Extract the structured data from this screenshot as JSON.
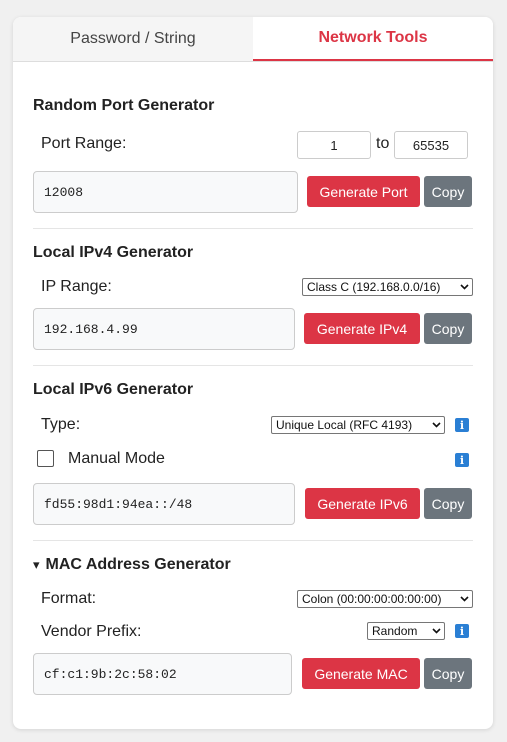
{
  "tabs": [
    {
      "label": "Password / String",
      "active": false
    },
    {
      "label": "Network Tools",
      "active": true
    }
  ],
  "port": {
    "title": "Random Port Generator",
    "range_label": "Port Range:",
    "min": "1",
    "to_label": "to",
    "max": "65535",
    "output": "12008",
    "generate_label": "Generate Port",
    "copy_label": "Copy"
  },
  "ipv4": {
    "title": "Local IPv4 Generator",
    "range_label": "IP Range:",
    "range_selected": "Class C (192.168.0.0/16)",
    "output": "192.168.4.99",
    "generate_label": "Generate IPv4",
    "copy_label": "Copy"
  },
  "ipv6": {
    "title": "Local IPv6 Generator",
    "type_label": "Type:",
    "type_selected": "Unique Local (RFC 4193)",
    "manual_label": "Manual Mode",
    "manual_checked": false,
    "output": "fd55:98d1:94ea::/48",
    "generate_label": "Generate IPv6",
    "copy_label": "Copy"
  },
  "mac": {
    "title": "MAC Address Generator",
    "collapse_glyph": "▾",
    "format_label": "Format:",
    "format_selected": "Colon (00:00:00:00:00:00)",
    "vendor_label": "Vendor Prefix:",
    "vendor_selected": "Random",
    "output": "cf:c1:9b:2c:58:02",
    "generate_label": "Generate MAC",
    "copy_label": "Copy"
  },
  "icons": {
    "info": "i",
    "chevron": "⌄"
  },
  "colors": {
    "accent": "#dc3545",
    "secondary": "#6c757d",
    "info": "#2a7fd4"
  }
}
